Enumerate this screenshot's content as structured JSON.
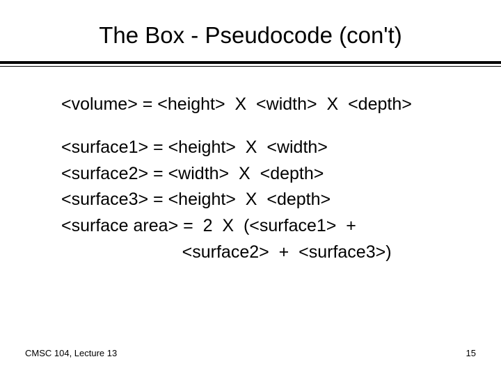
{
  "title": "The Box - Pseudocode (con't)",
  "lines": {
    "l1": "<volume> = <height>  X  <width>  X  <depth>",
    "l2": "<surface1> = <height>  X  <width>",
    "l3": "<surface2> = <width>  X  <depth>",
    "l4": "<surface3> = <height>  X  <depth>",
    "l5": "<surface area> =  2  X  (<surface1>  +",
    "l6": "                         <surface2>  +  <surface3>)"
  },
  "footer": {
    "left": "CMSC 104, Lecture 13",
    "right": "15"
  }
}
